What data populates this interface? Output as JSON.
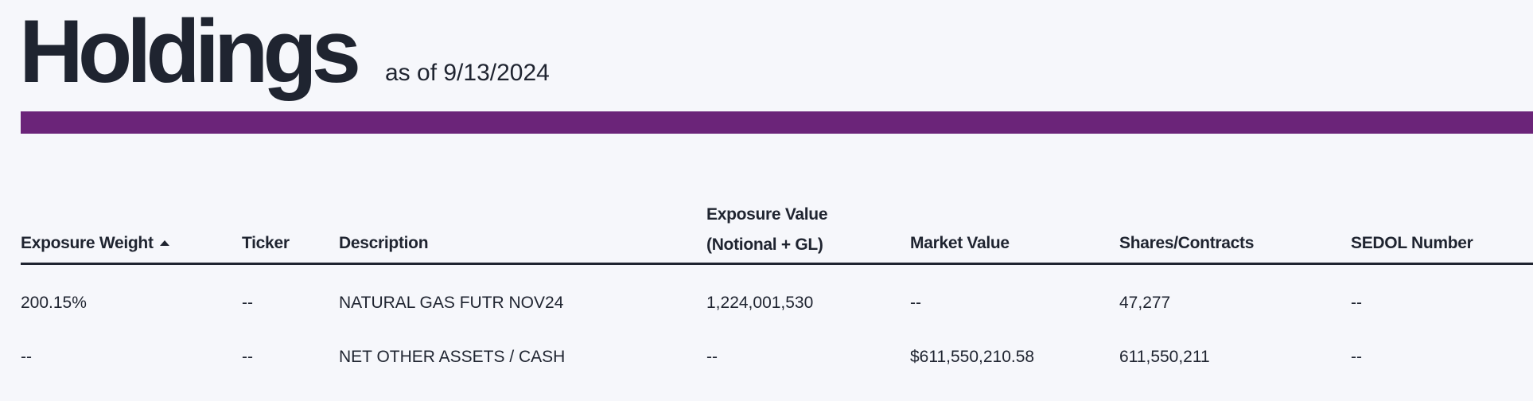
{
  "header": {
    "title": "Holdings",
    "as_of": "as of 9/13/2024",
    "accent_color": "#6b2479"
  },
  "table": {
    "columns": [
      {
        "label": "Exposure Weight",
        "sort": "ascending"
      },
      {
        "label": "Ticker"
      },
      {
        "label": "Description"
      },
      {
        "label_line1": "Exposure Value",
        "label_line2": "(Notional + GL)"
      },
      {
        "label": "Market Value"
      },
      {
        "label": "Shares/Contracts"
      },
      {
        "label": "SEDOL Number"
      }
    ],
    "rows": [
      [
        "200.15%",
        "--",
        "NATURAL GAS FUTR NOV24",
        "1,224,001,530",
        "--",
        "47,277",
        "--"
      ],
      [
        "--",
        "--",
        "NET OTHER ASSETS / CASH",
        "--",
        "$611,550,210.58",
        "611,550,211",
        "--"
      ]
    ]
  }
}
